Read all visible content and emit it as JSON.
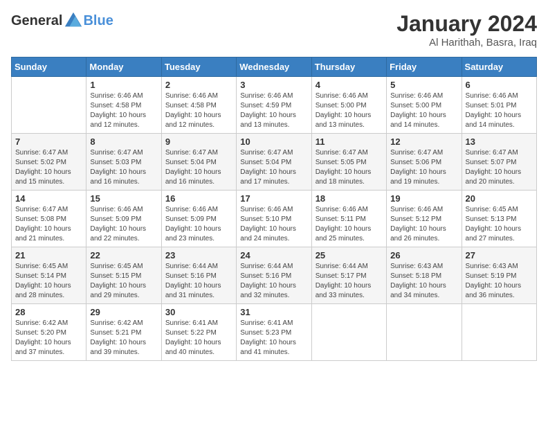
{
  "header": {
    "logo_general": "General",
    "logo_blue": "Blue",
    "month": "January 2024",
    "location": "Al Harithah, Basra, Iraq"
  },
  "weekdays": [
    "Sunday",
    "Monday",
    "Tuesday",
    "Wednesday",
    "Thursday",
    "Friday",
    "Saturday"
  ],
  "weeks": [
    [
      {
        "day": "",
        "sunrise": "",
        "sunset": "",
        "daylight": ""
      },
      {
        "day": "1",
        "sunrise": "Sunrise: 6:46 AM",
        "sunset": "Sunset: 4:58 PM",
        "daylight": "Daylight: 10 hours and 12 minutes."
      },
      {
        "day": "2",
        "sunrise": "Sunrise: 6:46 AM",
        "sunset": "Sunset: 4:58 PM",
        "daylight": "Daylight: 10 hours and 12 minutes."
      },
      {
        "day": "3",
        "sunrise": "Sunrise: 6:46 AM",
        "sunset": "Sunset: 4:59 PM",
        "daylight": "Daylight: 10 hours and 13 minutes."
      },
      {
        "day": "4",
        "sunrise": "Sunrise: 6:46 AM",
        "sunset": "Sunset: 5:00 PM",
        "daylight": "Daylight: 10 hours and 13 minutes."
      },
      {
        "day": "5",
        "sunrise": "Sunrise: 6:46 AM",
        "sunset": "Sunset: 5:00 PM",
        "daylight": "Daylight: 10 hours and 14 minutes."
      },
      {
        "day": "6",
        "sunrise": "Sunrise: 6:46 AM",
        "sunset": "Sunset: 5:01 PM",
        "daylight": "Daylight: 10 hours and 14 minutes."
      }
    ],
    [
      {
        "day": "7",
        "sunrise": "Sunrise: 6:47 AM",
        "sunset": "Sunset: 5:02 PM",
        "daylight": "Daylight: 10 hours and 15 minutes."
      },
      {
        "day": "8",
        "sunrise": "Sunrise: 6:47 AM",
        "sunset": "Sunset: 5:03 PM",
        "daylight": "Daylight: 10 hours and 16 minutes."
      },
      {
        "day": "9",
        "sunrise": "Sunrise: 6:47 AM",
        "sunset": "Sunset: 5:04 PM",
        "daylight": "Daylight: 10 hours and 16 minutes."
      },
      {
        "day": "10",
        "sunrise": "Sunrise: 6:47 AM",
        "sunset": "Sunset: 5:04 PM",
        "daylight": "Daylight: 10 hours and 17 minutes."
      },
      {
        "day": "11",
        "sunrise": "Sunrise: 6:47 AM",
        "sunset": "Sunset: 5:05 PM",
        "daylight": "Daylight: 10 hours and 18 minutes."
      },
      {
        "day": "12",
        "sunrise": "Sunrise: 6:47 AM",
        "sunset": "Sunset: 5:06 PM",
        "daylight": "Daylight: 10 hours and 19 minutes."
      },
      {
        "day": "13",
        "sunrise": "Sunrise: 6:47 AM",
        "sunset": "Sunset: 5:07 PM",
        "daylight": "Daylight: 10 hours and 20 minutes."
      }
    ],
    [
      {
        "day": "14",
        "sunrise": "Sunrise: 6:47 AM",
        "sunset": "Sunset: 5:08 PM",
        "daylight": "Daylight: 10 hours and 21 minutes."
      },
      {
        "day": "15",
        "sunrise": "Sunrise: 6:46 AM",
        "sunset": "Sunset: 5:09 PM",
        "daylight": "Daylight: 10 hours and 22 minutes."
      },
      {
        "day": "16",
        "sunrise": "Sunrise: 6:46 AM",
        "sunset": "Sunset: 5:09 PM",
        "daylight": "Daylight: 10 hours and 23 minutes."
      },
      {
        "day": "17",
        "sunrise": "Sunrise: 6:46 AM",
        "sunset": "Sunset: 5:10 PM",
        "daylight": "Daylight: 10 hours and 24 minutes."
      },
      {
        "day": "18",
        "sunrise": "Sunrise: 6:46 AM",
        "sunset": "Sunset: 5:11 PM",
        "daylight": "Daylight: 10 hours and 25 minutes."
      },
      {
        "day": "19",
        "sunrise": "Sunrise: 6:46 AM",
        "sunset": "Sunset: 5:12 PM",
        "daylight": "Daylight: 10 hours and 26 minutes."
      },
      {
        "day": "20",
        "sunrise": "Sunrise: 6:45 AM",
        "sunset": "Sunset: 5:13 PM",
        "daylight": "Daylight: 10 hours and 27 minutes."
      }
    ],
    [
      {
        "day": "21",
        "sunrise": "Sunrise: 6:45 AM",
        "sunset": "Sunset: 5:14 PM",
        "daylight": "Daylight: 10 hours and 28 minutes."
      },
      {
        "day": "22",
        "sunrise": "Sunrise: 6:45 AM",
        "sunset": "Sunset: 5:15 PM",
        "daylight": "Daylight: 10 hours and 29 minutes."
      },
      {
        "day": "23",
        "sunrise": "Sunrise: 6:44 AM",
        "sunset": "Sunset: 5:16 PM",
        "daylight": "Daylight: 10 hours and 31 minutes."
      },
      {
        "day": "24",
        "sunrise": "Sunrise: 6:44 AM",
        "sunset": "Sunset: 5:16 PM",
        "daylight": "Daylight: 10 hours and 32 minutes."
      },
      {
        "day": "25",
        "sunrise": "Sunrise: 6:44 AM",
        "sunset": "Sunset: 5:17 PM",
        "daylight": "Daylight: 10 hours and 33 minutes."
      },
      {
        "day": "26",
        "sunrise": "Sunrise: 6:43 AM",
        "sunset": "Sunset: 5:18 PM",
        "daylight": "Daylight: 10 hours and 34 minutes."
      },
      {
        "day": "27",
        "sunrise": "Sunrise: 6:43 AM",
        "sunset": "Sunset: 5:19 PM",
        "daylight": "Daylight: 10 hours and 36 minutes."
      }
    ],
    [
      {
        "day": "28",
        "sunrise": "Sunrise: 6:42 AM",
        "sunset": "Sunset: 5:20 PM",
        "daylight": "Daylight: 10 hours and 37 minutes."
      },
      {
        "day": "29",
        "sunrise": "Sunrise: 6:42 AM",
        "sunset": "Sunset: 5:21 PM",
        "daylight": "Daylight: 10 hours and 39 minutes."
      },
      {
        "day": "30",
        "sunrise": "Sunrise: 6:41 AM",
        "sunset": "Sunset: 5:22 PM",
        "daylight": "Daylight: 10 hours and 40 minutes."
      },
      {
        "day": "31",
        "sunrise": "Sunrise: 6:41 AM",
        "sunset": "Sunset: 5:23 PM",
        "daylight": "Daylight: 10 hours and 41 minutes."
      },
      {
        "day": "",
        "sunrise": "",
        "sunset": "",
        "daylight": ""
      },
      {
        "day": "",
        "sunrise": "",
        "sunset": "",
        "daylight": ""
      },
      {
        "day": "",
        "sunrise": "",
        "sunset": "",
        "daylight": ""
      }
    ]
  ]
}
